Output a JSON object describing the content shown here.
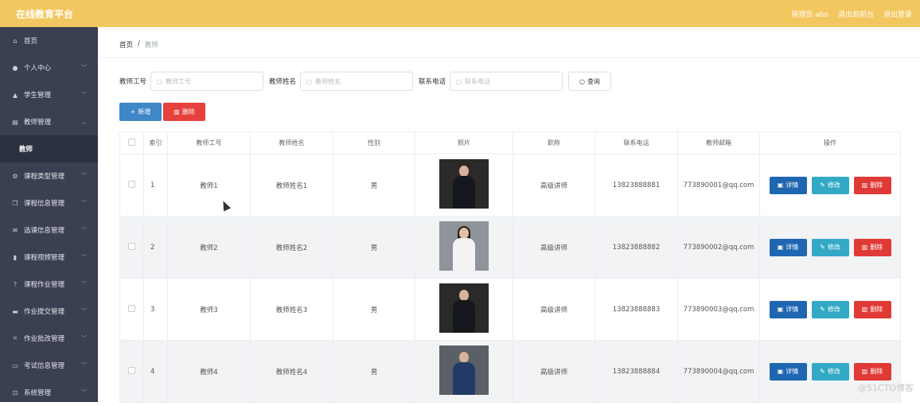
{
  "header": {
    "logo": "在线教育平台",
    "admin": "管理员 abo",
    "back_front": "退出到前台",
    "logout": "退出登录"
  },
  "sidebar": {
    "items": [
      {
        "label": "首页",
        "icon": "home-icon"
      },
      {
        "label": "个人中心",
        "icon": "user-icon"
      },
      {
        "label": "学生管理",
        "icon": "student-icon"
      },
      {
        "label": "教师管理",
        "icon": "teacher-icon",
        "expanded": true
      },
      {
        "label": "课程类型管理",
        "icon": "gear-icon"
      },
      {
        "label": "课程信息管理",
        "icon": "copy-icon"
      },
      {
        "label": "选课信息管理",
        "icon": "mail-icon"
      },
      {
        "label": "课程视频管理",
        "icon": "chart-icon"
      },
      {
        "label": "课程作业管理",
        "icon": "help-icon"
      },
      {
        "label": "作业提交管理",
        "icon": "list-icon"
      },
      {
        "label": "作业批改管理",
        "icon": "crop-icon"
      },
      {
        "label": "考试信息管理",
        "icon": "card-icon"
      },
      {
        "label": "系统管理",
        "icon": "system-icon"
      }
    ],
    "sub_item": "教师"
  },
  "breadcrumb": {
    "home": "首页",
    "sep": "/",
    "current": "教师"
  },
  "search": {
    "f1_label": "教师工号",
    "f1_placeholder": "教师工号",
    "f2_label": "教师姓名",
    "f2_placeholder": "教师姓名",
    "f3_label": "联系电话",
    "f3_placeholder": "联系电话",
    "query_label": "查询"
  },
  "actions": {
    "add_label": "新增",
    "delete_label": "删除"
  },
  "table": {
    "headers": [
      "索引",
      "教师工号",
      "教师姓名",
      "性别",
      "照片",
      "职称",
      "联系电话",
      "教师邮箱",
      "操作"
    ],
    "rows": [
      {
        "index": "1",
        "id": "教师1",
        "name": "教师姓名1",
        "gender": "男",
        "photo": "dark",
        "title": "高级讲师",
        "phone": "13823888881",
        "email": "773890001@qq.com"
      },
      {
        "index": "2",
        "id": "教师2",
        "name": "教师姓名2",
        "gender": "男",
        "photo": "light",
        "title": "高级讲师",
        "phone": "13823888882",
        "email": "773890002@qq.com"
      },
      {
        "index": "3",
        "id": "教师3",
        "name": "教师姓名3",
        "gender": "男",
        "photo": "dark",
        "title": "高级讲师",
        "phone": "13823888883",
        "email": "773890003@qq.com"
      },
      {
        "index": "4",
        "id": "教师4",
        "name": "教师姓名4",
        "gender": "男",
        "photo": "mid",
        "title": "高级讲师",
        "phone": "13823888884",
        "email": "773890004@qq.com"
      }
    ],
    "detail_label": "详情",
    "edit_label": "修改",
    "delete_label": "删除"
  },
  "watermark": "@51CTO博客",
  "colors": {
    "topbar": "#f2c75f",
    "sidebar": "#3a3f51",
    "primary": "#3f87c6",
    "danger": "#e6413d",
    "info": "#33a9c6"
  }
}
